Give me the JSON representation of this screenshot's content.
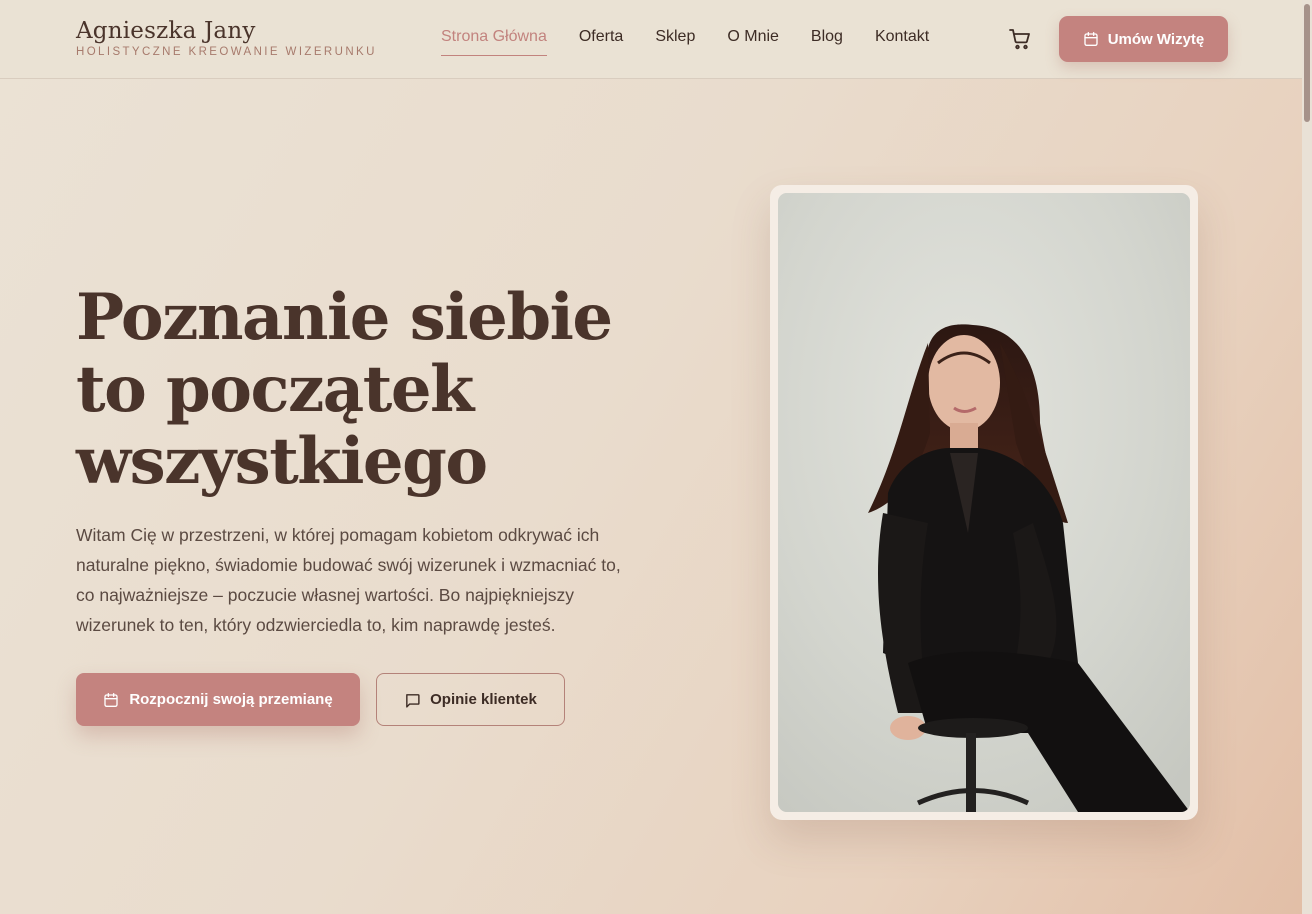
{
  "brand": {
    "name": "Agnieszka Jany",
    "tagline": "HOLISTYCZNE KREOWANIE WIZERUNKU"
  },
  "nav": {
    "items": [
      {
        "label": "Strona Główna",
        "active": true
      },
      {
        "label": "Oferta",
        "active": false
      },
      {
        "label": "Sklep",
        "active": false
      },
      {
        "label": "O Mnie",
        "active": false
      },
      {
        "label": "Blog",
        "active": false
      },
      {
        "label": "Kontakt",
        "active": false
      }
    ],
    "cart_icon": "cart-icon",
    "cta_label": "Umów Wizytę"
  },
  "hero": {
    "title_lines": [
      "Poznanie siebie",
      "to początek",
      "wszystkiego"
    ],
    "text": "Witam Cię w przestrzeni, w której pomagam kobietom odkrywać ich naturalne piękno, świadomie budować swój wizerunek i wzmacniać to, co najważniejsze – poczucie własnej wartości. Bo najpiękniejszy wizerunek to ten, który odzwierciedla to, kim naprawdę jesteś.",
    "primary_button": "Rozpocznij swoją przemianę",
    "secondary_button": "Opinie klientek"
  },
  "colors": {
    "accent": "#c4837f",
    "text_dark": "#4a342b",
    "header_bg": "#eae2d4"
  }
}
